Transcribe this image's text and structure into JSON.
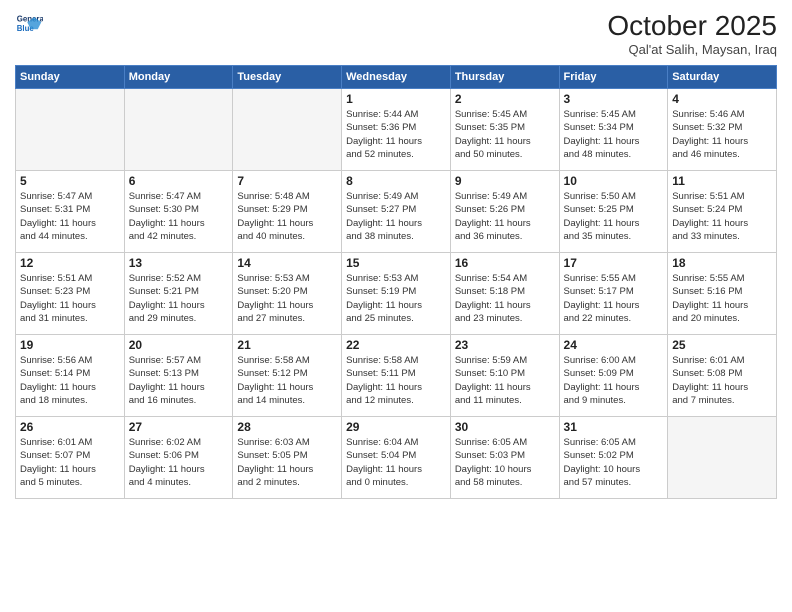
{
  "header": {
    "logo_line1": "General",
    "logo_line2": "Blue",
    "month_title": "October 2025",
    "subtitle": "Qal'at Salih, Maysan, Iraq"
  },
  "days_of_week": [
    "Sunday",
    "Monday",
    "Tuesday",
    "Wednesday",
    "Thursday",
    "Friday",
    "Saturday"
  ],
  "weeks": [
    [
      {
        "num": "",
        "info": ""
      },
      {
        "num": "",
        "info": ""
      },
      {
        "num": "",
        "info": ""
      },
      {
        "num": "1",
        "info": "Sunrise: 5:44 AM\nSunset: 5:36 PM\nDaylight: 11 hours\nand 52 minutes."
      },
      {
        "num": "2",
        "info": "Sunrise: 5:45 AM\nSunset: 5:35 PM\nDaylight: 11 hours\nand 50 minutes."
      },
      {
        "num": "3",
        "info": "Sunrise: 5:45 AM\nSunset: 5:34 PM\nDaylight: 11 hours\nand 48 minutes."
      },
      {
        "num": "4",
        "info": "Sunrise: 5:46 AM\nSunset: 5:32 PM\nDaylight: 11 hours\nand 46 minutes."
      }
    ],
    [
      {
        "num": "5",
        "info": "Sunrise: 5:47 AM\nSunset: 5:31 PM\nDaylight: 11 hours\nand 44 minutes."
      },
      {
        "num": "6",
        "info": "Sunrise: 5:47 AM\nSunset: 5:30 PM\nDaylight: 11 hours\nand 42 minutes."
      },
      {
        "num": "7",
        "info": "Sunrise: 5:48 AM\nSunset: 5:29 PM\nDaylight: 11 hours\nand 40 minutes."
      },
      {
        "num": "8",
        "info": "Sunrise: 5:49 AM\nSunset: 5:27 PM\nDaylight: 11 hours\nand 38 minutes."
      },
      {
        "num": "9",
        "info": "Sunrise: 5:49 AM\nSunset: 5:26 PM\nDaylight: 11 hours\nand 36 minutes."
      },
      {
        "num": "10",
        "info": "Sunrise: 5:50 AM\nSunset: 5:25 PM\nDaylight: 11 hours\nand 35 minutes."
      },
      {
        "num": "11",
        "info": "Sunrise: 5:51 AM\nSunset: 5:24 PM\nDaylight: 11 hours\nand 33 minutes."
      }
    ],
    [
      {
        "num": "12",
        "info": "Sunrise: 5:51 AM\nSunset: 5:23 PM\nDaylight: 11 hours\nand 31 minutes."
      },
      {
        "num": "13",
        "info": "Sunrise: 5:52 AM\nSunset: 5:21 PM\nDaylight: 11 hours\nand 29 minutes."
      },
      {
        "num": "14",
        "info": "Sunrise: 5:53 AM\nSunset: 5:20 PM\nDaylight: 11 hours\nand 27 minutes."
      },
      {
        "num": "15",
        "info": "Sunrise: 5:53 AM\nSunset: 5:19 PM\nDaylight: 11 hours\nand 25 minutes."
      },
      {
        "num": "16",
        "info": "Sunrise: 5:54 AM\nSunset: 5:18 PM\nDaylight: 11 hours\nand 23 minutes."
      },
      {
        "num": "17",
        "info": "Sunrise: 5:55 AM\nSunset: 5:17 PM\nDaylight: 11 hours\nand 22 minutes."
      },
      {
        "num": "18",
        "info": "Sunrise: 5:55 AM\nSunset: 5:16 PM\nDaylight: 11 hours\nand 20 minutes."
      }
    ],
    [
      {
        "num": "19",
        "info": "Sunrise: 5:56 AM\nSunset: 5:14 PM\nDaylight: 11 hours\nand 18 minutes."
      },
      {
        "num": "20",
        "info": "Sunrise: 5:57 AM\nSunset: 5:13 PM\nDaylight: 11 hours\nand 16 minutes."
      },
      {
        "num": "21",
        "info": "Sunrise: 5:58 AM\nSunset: 5:12 PM\nDaylight: 11 hours\nand 14 minutes."
      },
      {
        "num": "22",
        "info": "Sunrise: 5:58 AM\nSunset: 5:11 PM\nDaylight: 11 hours\nand 12 minutes."
      },
      {
        "num": "23",
        "info": "Sunrise: 5:59 AM\nSunset: 5:10 PM\nDaylight: 11 hours\nand 11 minutes."
      },
      {
        "num": "24",
        "info": "Sunrise: 6:00 AM\nSunset: 5:09 PM\nDaylight: 11 hours\nand 9 minutes."
      },
      {
        "num": "25",
        "info": "Sunrise: 6:01 AM\nSunset: 5:08 PM\nDaylight: 11 hours\nand 7 minutes."
      }
    ],
    [
      {
        "num": "26",
        "info": "Sunrise: 6:01 AM\nSunset: 5:07 PM\nDaylight: 11 hours\nand 5 minutes."
      },
      {
        "num": "27",
        "info": "Sunrise: 6:02 AM\nSunset: 5:06 PM\nDaylight: 11 hours\nand 4 minutes."
      },
      {
        "num": "28",
        "info": "Sunrise: 6:03 AM\nSunset: 5:05 PM\nDaylight: 11 hours\nand 2 minutes."
      },
      {
        "num": "29",
        "info": "Sunrise: 6:04 AM\nSunset: 5:04 PM\nDaylight: 11 hours\nand 0 minutes."
      },
      {
        "num": "30",
        "info": "Sunrise: 6:05 AM\nSunset: 5:03 PM\nDaylight: 10 hours\nand 58 minutes."
      },
      {
        "num": "31",
        "info": "Sunrise: 6:05 AM\nSunset: 5:02 PM\nDaylight: 10 hours\nand 57 minutes."
      },
      {
        "num": "",
        "info": ""
      }
    ]
  ]
}
